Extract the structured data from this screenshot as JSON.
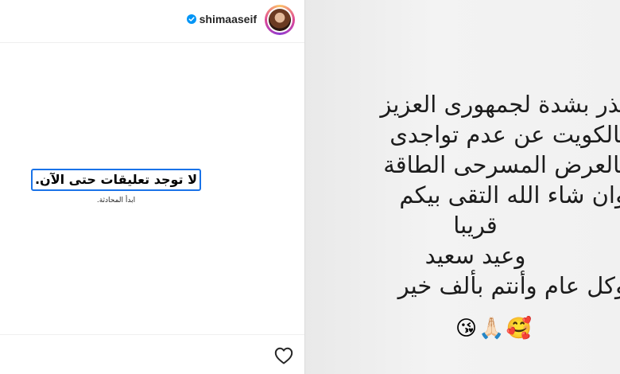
{
  "header": {
    "username": "shimaaseif",
    "verified": true,
    "verified_color": "#0095f6"
  },
  "comments": {
    "empty_title": "لا توجد تعليقات حتى الآن.",
    "empty_subtitle": "ابدأ المحادثة."
  },
  "story": {
    "lines": [
      "تذر بشدة لجمهورى العزيز",
      "بالكويت عن عدم تواجدى",
      "بالعرض المسرحى الطاقة",
      "وان شاء الله التقى بيكم",
      "قريبا",
      "وعيد سعيد",
      "وكل عام وأنتم بألف خير"
    ],
    "emojis": [
      "😘",
      "🙏🏻",
      "🥰"
    ]
  },
  "footer": {
    "like_icon": "heart-icon"
  }
}
